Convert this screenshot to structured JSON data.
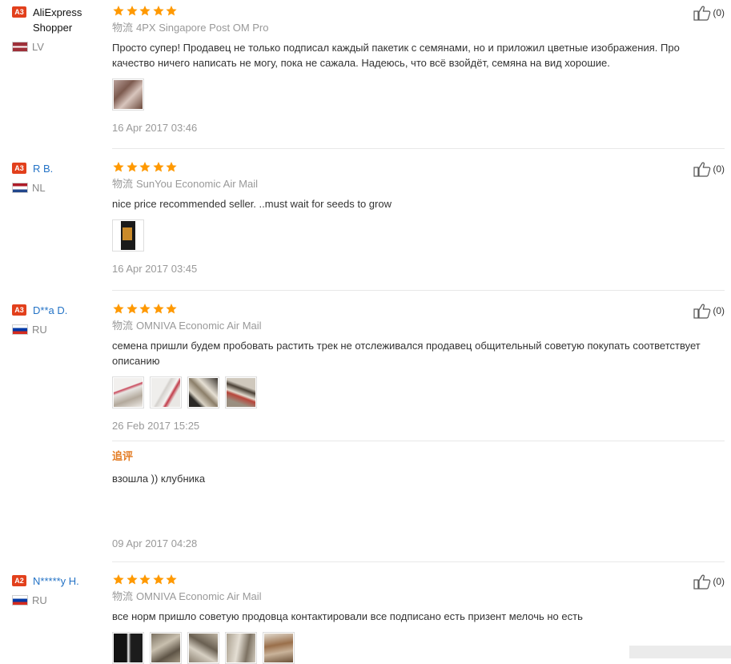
{
  "rating_color": "#ff9900",
  "reviews": [
    {
      "level": "A3",
      "name": "AliExpress Shopper",
      "country": "LV",
      "shipping_label": "物流",
      "shipping": "4PX Singapore Post OM Pro",
      "text": "Просто супер! Продавец не только подписал каждый пакетик с семянами, но и приложил цветные изображения. Про качество ничего написать не могу, пока не сажала. Надеюсь, что всё взойдёт, семяна на вид хорошие.",
      "date": "16 Apr 2017 03:46",
      "likes": "(0)"
    },
    {
      "level": "A3",
      "name": "R B.",
      "country": "NL",
      "shipping_label": "物流",
      "shipping": "SunYou Economic Air Mail",
      "text": "nice price recommended seller. ..must wait for seeds to grow",
      "date": "16 Apr 2017 03:45",
      "likes": "(0)"
    },
    {
      "level": "A3",
      "name": "D**a D.",
      "country": "RU",
      "shipping_label": "物流",
      "shipping": "OMNIVA Economic Air Mail",
      "text": "семена пришли будем пробовать растить трек не отслеживался продавец общительный советую покупать соответствует описанию",
      "date": "26 Feb 2017 15:25",
      "likes": "(0)",
      "followup_label": "追评",
      "followup_text": "взошла )) клубника",
      "followup_date": "09 Apr 2017 04:28"
    },
    {
      "level": "A2",
      "name": "N*****y H.",
      "country": "RU",
      "shipping_label": "物流",
      "shipping": "OMNIVA Economic Air Mail",
      "text": "все норм пришло советую продовца контактировали все подписано есть призент мелочь но есть",
      "likes": "(0)"
    }
  ]
}
